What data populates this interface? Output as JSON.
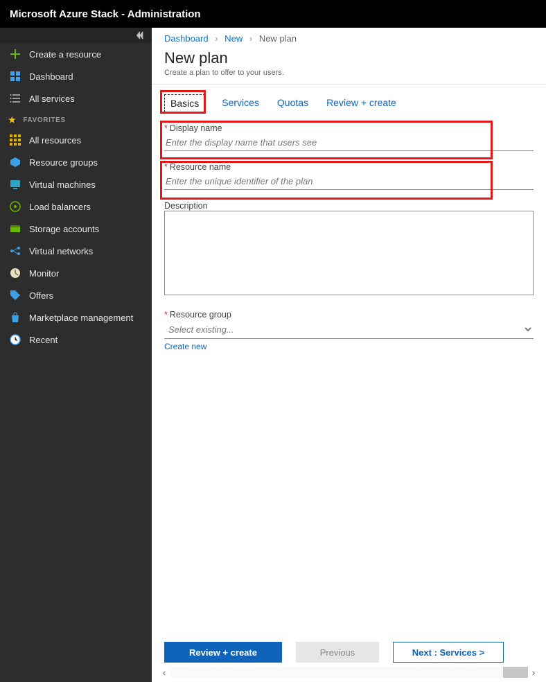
{
  "header": {
    "title": "Microsoft Azure Stack - Administration"
  },
  "sidebar": {
    "create": "Create a resource",
    "dashboard": "Dashboard",
    "allservices": "All services",
    "fav_label": "FAVORITES",
    "items": [
      {
        "label": "All resources"
      },
      {
        "label": "Resource groups"
      },
      {
        "label": "Virtual machines"
      },
      {
        "label": "Load balancers"
      },
      {
        "label": "Storage accounts"
      },
      {
        "label": "Virtual networks"
      },
      {
        "label": "Monitor"
      },
      {
        "label": "Offers"
      },
      {
        "label": "Marketplace management"
      },
      {
        "label": "Recent"
      }
    ]
  },
  "breadcrumb": {
    "a": "Dashboard",
    "b": "New",
    "c": "New plan"
  },
  "page": {
    "title": "New plan",
    "subtitle": "Create a plan to offer to your users."
  },
  "tabs": {
    "basics": "Basics",
    "services": "Services",
    "quotas": "Quotas",
    "review": "Review + create"
  },
  "form": {
    "display_label": "Display name",
    "display_ph": "Enter the display name that users see",
    "resource_label": "Resource name",
    "resource_ph": "Enter the unique identifier of the plan",
    "desc_label": "Description",
    "rg_label": "Resource group",
    "rg_ph": "Select existing...",
    "create_new": "Create new"
  },
  "footer": {
    "review": "Review + create",
    "prev": "Previous",
    "next": "Next : Services >"
  }
}
